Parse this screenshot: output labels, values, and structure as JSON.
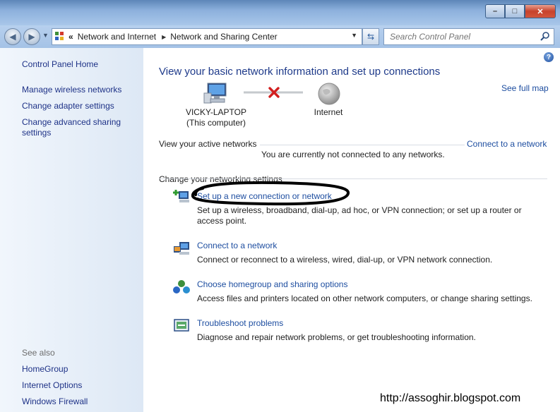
{
  "window": {
    "controls": {
      "minimize": "–",
      "maximize": "□",
      "close": "✕"
    }
  },
  "address": {
    "chevron": "«",
    "crumbs": [
      "Network and Internet",
      "Network and Sharing Center"
    ],
    "search_placeholder": "Search Control Panel"
  },
  "sidebar": {
    "home": "Control Panel Home",
    "links": [
      "Manage wireless networks",
      "Change adapter settings",
      "Change advanced sharing settings"
    ],
    "see_also_label": "See also",
    "see_also": [
      "HomeGroup",
      "Internet Options",
      "Windows Firewall"
    ]
  },
  "main": {
    "heading": "View your basic network information and set up connections",
    "see_full_map": "See full map",
    "map": {
      "computer_name": "VICKY-LAPTOP",
      "computer_sub": "(This computer)",
      "internet": "Internet"
    },
    "active_networks_label": "View your active networks",
    "connect_link": "Connect to a network",
    "not_connected": "You are currently not connected to any networks.",
    "settings_label": "Change your networking settings",
    "tasks": [
      {
        "title": "Set up a new connection or network",
        "desc": "Set up a wireless, broadband, dial-up, ad hoc, or VPN connection; or set up a router or access point.",
        "icon": "new-connection-icon"
      },
      {
        "title": "Connect to a network",
        "desc": "Connect or reconnect to a wireless, wired, dial-up, or VPN network connection.",
        "icon": "connect-network-icon"
      },
      {
        "title": "Choose homegroup and sharing options",
        "desc": "Access files and printers located on other network computers, or change sharing settings.",
        "icon": "homegroup-icon"
      },
      {
        "title": "Troubleshoot problems",
        "desc": "Diagnose and repair network problems, or get troubleshooting information.",
        "icon": "troubleshoot-icon"
      }
    ]
  },
  "watermark": "http://assoghir.blogspot.com",
  "colors": {
    "link": "#1e4ea0",
    "heading": "#1e3a8a",
    "titlebar": "#8cb0dc"
  }
}
